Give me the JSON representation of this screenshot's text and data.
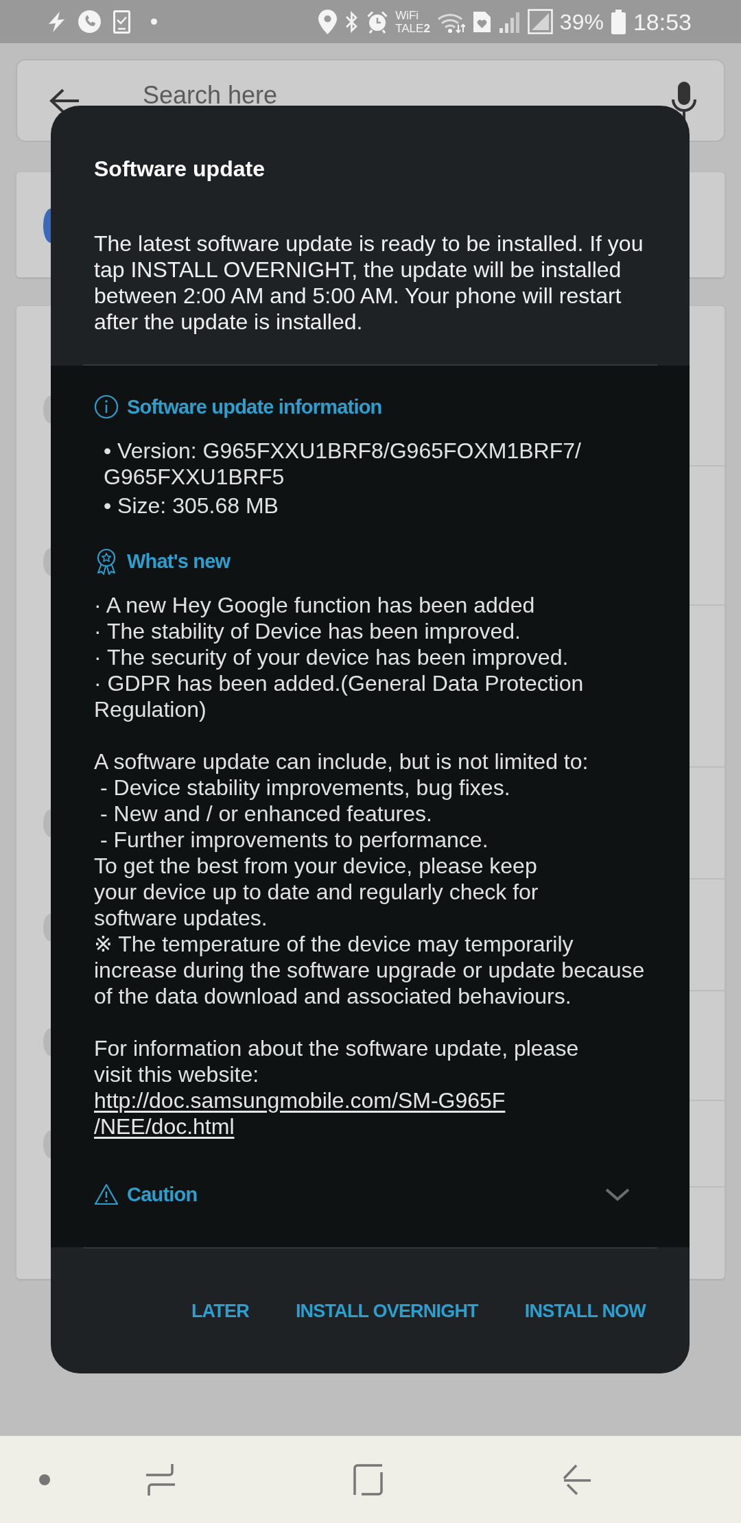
{
  "status_bar": {
    "wifi_label": "WiFi",
    "network_label": "TALE**2**",
    "battery": "39%",
    "time": "18:53"
  },
  "background_app": {
    "search_field": {
      "placeholder": "Search here"
    }
  },
  "dialog": {
    "title": "Software update",
    "message": "The latest software update is ready to be installed. If you tap INSTALL OVERNIGHT, the update will be installed between 2:00 AM and 5:00 AM. Your phone will restart after the update is installed.",
    "sections": [
      {
        "kind": "info",
        "heading": "Software update information",
        "items": [
          "• Version: G965FXXU1BRF8/G965FOXM1BRF7/G965FXXU1BRF5",
          "• Size: 305.68 MB"
        ]
      },
      {
        "kind": "whats_new",
        "heading": "What's new",
        "items": [
          "· A new Hey Google function has been added",
          "· The stability of Device has been improved.",
          "· The security of your device has been improved.",
          "· GDPR has been added.(General Data Protection Regulation)"
        ]
      }
    ],
    "details": {
      "intro": "A software update can include, but is not limited to:",
      "points": [
        "- Device stability improvements, bug fixes.",
        "- New and / or enhanced features.",
        "- Further improvements to performance."
      ],
      "advice": "To get the best from your device, please keep\nyour device up to date and regularly check for\nsoftware updates.",
      "note": "※ The temperature of the device may temporarily\nincrease during the software upgrade or update because\nof the data download and associated behaviours."
    },
    "website": {
      "text": "For information about the software update, please\nvisit this website:",
      "link": "http://doc.samsungmobile.com/SM-G965F\n/NEE/doc.html"
    },
    "caution": {
      "heading": "Caution",
      "expanded": false
    },
    "buttons": [
      {
        "label": "LATER"
      },
      {
        "label": "INSTALL OVERNIGHT"
      },
      {
        "label": "INSTALL NOW"
      }
    ]
  }
}
